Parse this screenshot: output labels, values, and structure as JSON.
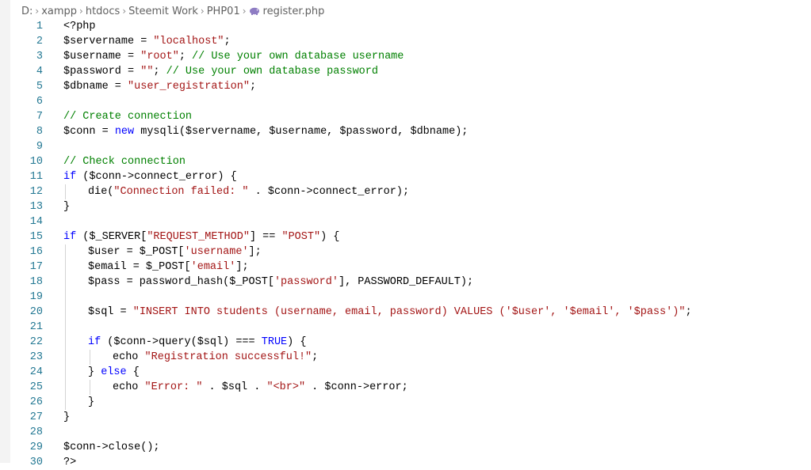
{
  "breadcrumb": [
    "D:",
    "xampp",
    "htdocs",
    "Steemit Work",
    "PHP01",
    "register.php"
  ],
  "colors": {
    "keyword": "#0000ff",
    "string": "#a31515",
    "comment": "#008000",
    "line_number": "#237893",
    "php_icon": "#8e7cc3"
  },
  "file_icon": "php-elephant-icon",
  "lines": [
    {
      "n": "1",
      "indent": 0,
      "tokens": [
        {
          "t": "<?php",
          "c": "pl"
        }
      ]
    },
    {
      "n": "2",
      "indent": 0,
      "tokens": [
        {
          "t": "$servername = ",
          "c": "pl"
        },
        {
          "t": "\"localhost\"",
          "c": "str"
        },
        {
          "t": ";",
          "c": "pl"
        }
      ]
    },
    {
      "n": "3",
      "indent": 0,
      "tokens": [
        {
          "t": "$username = ",
          "c": "pl"
        },
        {
          "t": "\"root\"",
          "c": "str"
        },
        {
          "t": "; ",
          "c": "pl"
        },
        {
          "t": "// Use your own database username",
          "c": "com"
        }
      ]
    },
    {
      "n": "4",
      "indent": 0,
      "tokens": [
        {
          "t": "$password = ",
          "c": "pl"
        },
        {
          "t": "\"\"",
          "c": "str"
        },
        {
          "t": "; ",
          "c": "pl"
        },
        {
          "t": "// Use your own database password",
          "c": "com"
        }
      ]
    },
    {
      "n": "5",
      "indent": 0,
      "tokens": [
        {
          "t": "$dbname = ",
          "c": "pl"
        },
        {
          "t": "\"user_registration\"",
          "c": "str"
        },
        {
          "t": ";",
          "c": "pl"
        }
      ]
    },
    {
      "n": "6",
      "indent": 0,
      "tokens": []
    },
    {
      "n": "7",
      "indent": 0,
      "tokens": [
        {
          "t": "// Create connection",
          "c": "com"
        }
      ]
    },
    {
      "n": "8",
      "indent": 0,
      "tokens": [
        {
          "t": "$conn = ",
          "c": "pl"
        },
        {
          "t": "new",
          "c": "kw"
        },
        {
          "t": " mysqli($servername, $username, $password, $dbname);",
          "c": "pl"
        }
      ]
    },
    {
      "n": "9",
      "indent": 0,
      "tokens": []
    },
    {
      "n": "10",
      "indent": 0,
      "tokens": [
        {
          "t": "// Check connection",
          "c": "com"
        }
      ]
    },
    {
      "n": "11",
      "indent": 0,
      "tokens": [
        {
          "t": "if",
          "c": "kw"
        },
        {
          "t": " ($conn->connect_error) {",
          "c": "pl"
        }
      ]
    },
    {
      "n": "12",
      "indent": 1,
      "tokens": [
        {
          "t": "die(",
          "c": "pl"
        },
        {
          "t": "\"Connection failed: \"",
          "c": "str"
        },
        {
          "t": " . $conn->connect_error);",
          "c": "pl"
        }
      ]
    },
    {
      "n": "13",
      "indent": 0,
      "tokens": [
        {
          "t": "}",
          "c": "pl"
        }
      ]
    },
    {
      "n": "14",
      "indent": 0,
      "tokens": []
    },
    {
      "n": "15",
      "indent": 0,
      "tokens": [
        {
          "t": "if",
          "c": "kw"
        },
        {
          "t": " ($_SERVER[",
          "c": "pl"
        },
        {
          "t": "\"REQUEST_METHOD\"",
          "c": "str"
        },
        {
          "t": "] == ",
          "c": "pl"
        },
        {
          "t": "\"POST\"",
          "c": "str"
        },
        {
          "t": ") {",
          "c": "pl"
        }
      ]
    },
    {
      "n": "16",
      "indent": 1,
      "tokens": [
        {
          "t": "$user = $_POST[",
          "c": "pl"
        },
        {
          "t": "'username'",
          "c": "str"
        },
        {
          "t": "];",
          "c": "pl"
        }
      ]
    },
    {
      "n": "17",
      "indent": 1,
      "tokens": [
        {
          "t": "$email = $_POST[",
          "c": "pl"
        },
        {
          "t": "'email'",
          "c": "str"
        },
        {
          "t": "];",
          "c": "pl"
        }
      ]
    },
    {
      "n": "18",
      "indent": 1,
      "tokens": [
        {
          "t": "$pass = password_hash($_POST[",
          "c": "pl"
        },
        {
          "t": "'password'",
          "c": "str"
        },
        {
          "t": "], PASSWORD_DEFAULT);",
          "c": "pl"
        }
      ]
    },
    {
      "n": "19",
      "indent": 1,
      "tokens": []
    },
    {
      "n": "20",
      "indent": 1,
      "tokens": [
        {
          "t": "$sql = ",
          "c": "pl"
        },
        {
          "t": "\"INSERT INTO students (username, email, password) VALUES ('$user', '$email', '$pass')\"",
          "c": "str"
        },
        {
          "t": ";",
          "c": "pl"
        }
      ]
    },
    {
      "n": "21",
      "indent": 1,
      "tokens": []
    },
    {
      "n": "22",
      "indent": 1,
      "tokens": [
        {
          "t": "if",
          "c": "kw"
        },
        {
          "t": " ($conn->query($sql) === ",
          "c": "pl"
        },
        {
          "t": "TRUE",
          "c": "kw"
        },
        {
          "t": ") {",
          "c": "pl"
        }
      ]
    },
    {
      "n": "23",
      "indent": 2,
      "tokens": [
        {
          "t": "echo ",
          "c": "pl"
        },
        {
          "t": "\"Registration successful!\"",
          "c": "str"
        },
        {
          "t": ";",
          "c": "pl"
        }
      ]
    },
    {
      "n": "24",
      "indent": 1,
      "tokens": [
        {
          "t": "} ",
          "c": "pl"
        },
        {
          "t": "else",
          "c": "kw"
        },
        {
          "t": " {",
          "c": "pl"
        }
      ]
    },
    {
      "n": "25",
      "indent": 2,
      "tokens": [
        {
          "t": "echo ",
          "c": "pl"
        },
        {
          "t": "\"Error: \"",
          "c": "str"
        },
        {
          "t": " . $sql . ",
          "c": "pl"
        },
        {
          "t": "\"<br>\"",
          "c": "str"
        },
        {
          "t": " . $conn->error;",
          "c": "pl"
        }
      ]
    },
    {
      "n": "26",
      "indent": 1,
      "tokens": [
        {
          "t": "}",
          "c": "pl"
        }
      ]
    },
    {
      "n": "27",
      "indent": 0,
      "tokens": [
        {
          "t": "}",
          "c": "pl"
        }
      ]
    },
    {
      "n": "28",
      "indent": 0,
      "tokens": []
    },
    {
      "n": "29",
      "indent": 0,
      "tokens": [
        {
          "t": "$conn->close();",
          "c": "pl"
        }
      ]
    },
    {
      "n": "30",
      "indent": 0,
      "tokens": [
        {
          "t": "?>",
          "c": "pl"
        }
      ]
    }
  ]
}
